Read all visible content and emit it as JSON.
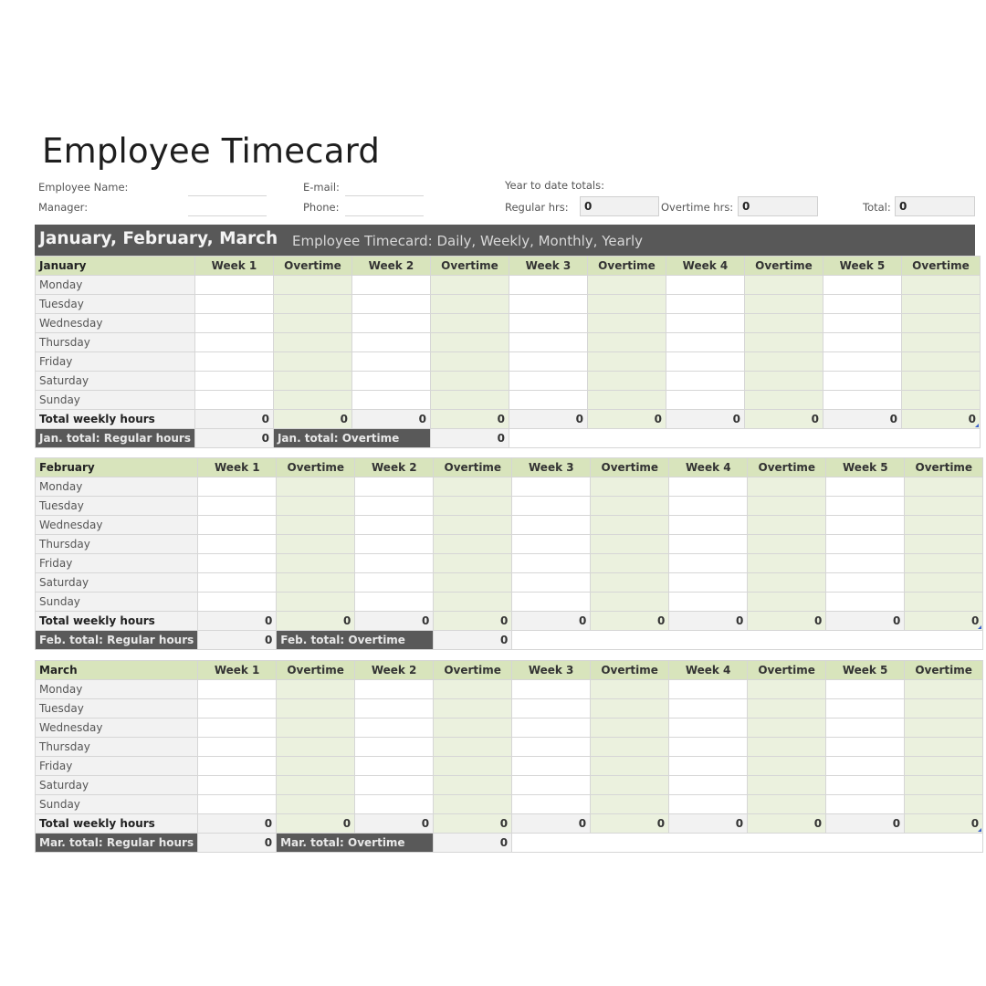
{
  "title": "Employee Timecard",
  "info": {
    "employee_name_label": "Employee Name:",
    "employee_name_value": "",
    "manager_label": "Manager:",
    "manager_value": "",
    "email_label": "E-mail:",
    "email_value": "",
    "phone_label": "Phone:",
    "phone_value": ""
  },
  "ytd": {
    "heading": "Year to date totals:",
    "regular_label": "Regular hrs:",
    "regular_value": "0",
    "overtime_label": "Overtime hrs:",
    "overtime_value": "0",
    "total_label": "Total:",
    "total_value": "0"
  },
  "banner": {
    "quarter": "January, February, March",
    "subtitle": "Employee Timecard: Daily, Weekly, Monthly, Yearly"
  },
  "columns": [
    "Week 1",
    "Overtime",
    "Week 2",
    "Overtime",
    "Week 3",
    "Overtime",
    "Week 4",
    "Overtime",
    "Week 5",
    "Overtime"
  ],
  "days": [
    "Monday",
    "Tuesday",
    "Wednesday",
    "Thursday",
    "Friday",
    "Saturday",
    "Sunday"
  ],
  "total_weekly_label": "Total weekly hours",
  "months": [
    {
      "name": "January",
      "weekly_totals": [
        "0",
        "0",
        "0",
        "0",
        "0",
        "0",
        "0",
        "0",
        "0",
        "0"
      ],
      "regular_total_label": "Jan. total: Regular hours",
      "regular_total_value": "0",
      "overtime_total_label": "Jan. total: Overtime",
      "overtime_total_value": "0"
    },
    {
      "name": "February",
      "weekly_totals": [
        "0",
        "0",
        "0",
        "0",
        "0",
        "0",
        "0",
        "0",
        "0",
        "0"
      ],
      "regular_total_label": "Feb. total: Regular hours",
      "regular_total_value": "0",
      "overtime_total_label": "Feb.  total: Overtime",
      "overtime_total_value": "0"
    },
    {
      "name": "March",
      "weekly_totals": [
        "0",
        "0",
        "0",
        "0",
        "0",
        "0",
        "0",
        "0",
        "0",
        "0"
      ],
      "regular_total_label": "Mar. total: Regular hours",
      "regular_total_value": "0",
      "overtime_total_label": "Mar. total: Overtime",
      "overtime_total_value": "0"
    }
  ]
}
